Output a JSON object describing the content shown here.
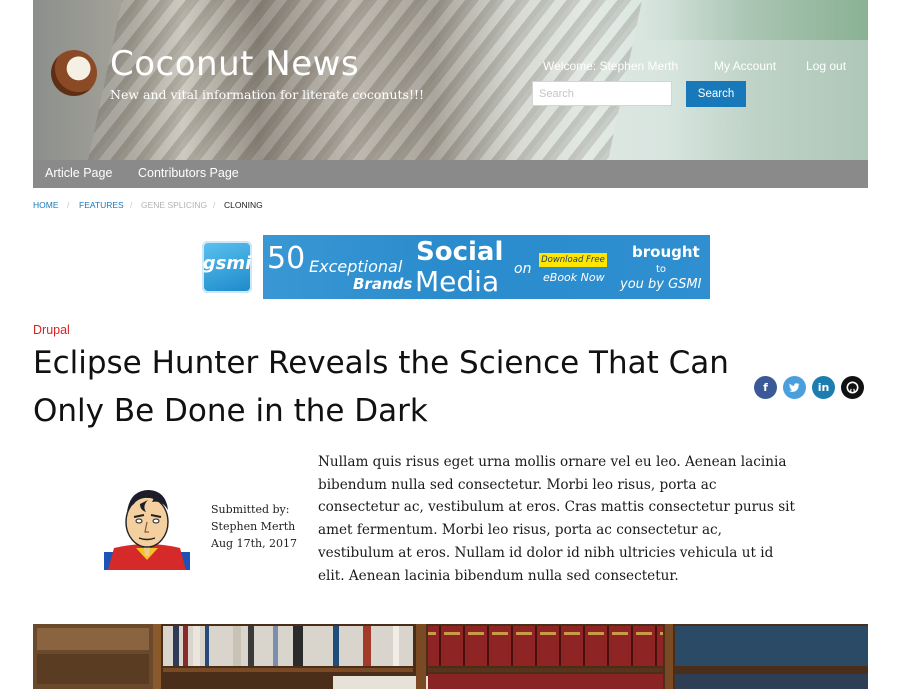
{
  "header": {
    "site_name": "Coconut News",
    "slogan": "New and vital information for literate coconuts!!!",
    "welcome": "Welcome: Stephen Merth",
    "my_account": "My Account",
    "log_out": "Log out",
    "search_placeholder": "Search",
    "search_value": "",
    "search_button": "Search"
  },
  "nav": {
    "items": [
      {
        "label": "Article Page"
      },
      {
        "label": "Contributors Page"
      }
    ]
  },
  "breadcrumb": {
    "items": [
      "Home",
      "Features",
      "Gene Splicing",
      "Cloning"
    ],
    "separator": "/"
  },
  "ad": {
    "logo_text": "gsmi",
    "line_50": "50",
    "exceptional": "Exceptional",
    "brands": "Brands",
    "social": "Social",
    "media": "Media",
    "on": "on",
    "download_free": "Download Free",
    "ebook_now": "eBook Now",
    "brought": "brought",
    "to": "to",
    "you_by": "you by GSMI"
  },
  "article": {
    "category": "Drupal",
    "title": "Eclipse Hunter Reveals the Science That Can Only Be Done in the Dark",
    "submitted_by_label": "Submitted by:",
    "author": "Stephen Merth",
    "date": "Aug 17th, 2017",
    "body": "Nullam quis risus eget urna mollis ornare vel eu leo. Aenean lacinia bibendum nulla sed consectetur. Morbi leo risus, porta ac consectetur ac, vestibulum at eros. Cras mattis consectetur purus sit amet fermentum. Morbi leo risus, porta ac consectetur ac, vestibulum at eros. Nullam id dolor id nibh ultricies vehicula ut id elit. Aenean lacinia bibendum nulla sed consectetur."
  },
  "share": {
    "facebook": "f",
    "twitter": "t",
    "linkedin": "in",
    "github": "gh"
  },
  "colors": {
    "accent_blue": "#1779ba",
    "category_red": "#d62222",
    "nav_gray": "#8a8a8a"
  }
}
